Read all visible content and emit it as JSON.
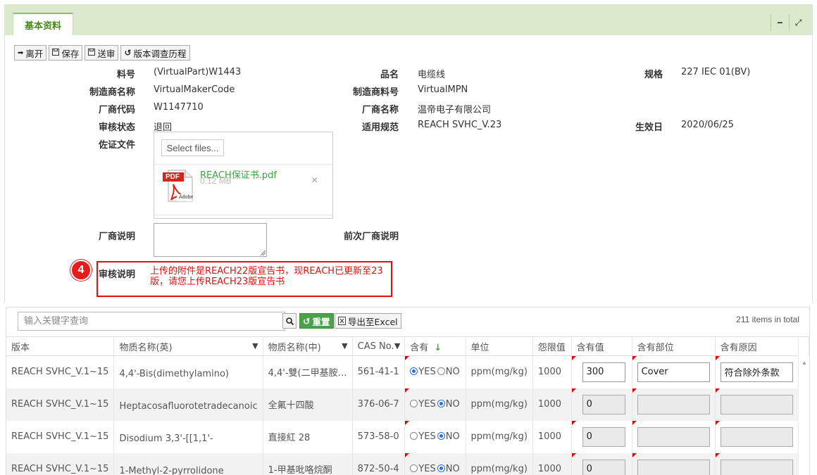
{
  "header": {
    "tab_label": "基本资料",
    "minimize_glyph": "−",
    "expand_glyph": "⤢"
  },
  "toolbar": {
    "leave_label": "离开",
    "save_label": "保存",
    "submit_label": "送审",
    "history_label": "版本调查历程"
  },
  "form": {
    "part_no_label": "料号",
    "part_no": "(VirtualPart)W1443",
    "product_name_label": "品名",
    "product_name": "电缆线",
    "spec_label": "规格",
    "spec": "227 IEC 01(BV)",
    "maker_name_label": "制造商名称",
    "maker_name": "VirtualMakerCode",
    "maker_part_label": "制造商料号",
    "maker_part": "VirtualMPN",
    "vendor_code_label": "厂商代码",
    "vendor_code": "W1147710",
    "vendor_name_label": "厂商名称",
    "vendor_name": "温帝电子有限公司",
    "audit_status_label": "审核状态",
    "audit_status": "退回",
    "regulation_label": "适用规范",
    "regulation": "REACH SVHC_V.23",
    "effective_date_label": "生效日",
    "effective_date": "2020/06/25",
    "evidence_label": "佐证文件",
    "select_files_label": "Select files...",
    "file_name": "REACH保证书.pdf",
    "file_size": "0.12 MB",
    "file_icon_text": "PDF",
    "file_icon_brand": "Adobe",
    "remove_glyph": "×",
    "vendor_note_label": "厂商说明",
    "prev_vendor_note_label": "前次厂商说明",
    "audit_note_label": "审核说明",
    "audit_note": "上传的附件是REACH22版宣告书，现REACH已更新至23版，请您上传REACH23版宣告书",
    "step_badge": "4"
  },
  "grid": {
    "search_placeholder": "输入关键字查询",
    "reset_label": "重置",
    "export_label": "导出至Excel",
    "total_text": "211 items in total",
    "columns": [
      "版本",
      "物质名称(英)",
      "物质名称(中)",
      "CAS No.",
      "含有",
      "单位",
      "怨限值",
      "含有值",
      "含有部位",
      "含有原因"
    ],
    "sort_glyph": "↓",
    "yes_label": "YES",
    "no_label": "NO",
    "rows": [
      {
        "version": "REACH SVHC_V.1~15",
        "name_en": "4,4'-Bis(dimethylamino)",
        "name_cn": "4,4'-雙(二甲基胺…",
        "cas": "561-41-1",
        "contains": "yes",
        "unit": "ppm(mg/kg)",
        "limit": "1000",
        "value": "300",
        "part": "Cover",
        "reason": "符合除外条款"
      },
      {
        "version": "REACH SVHC_V.1~15",
        "name_en": "Heptacosafluorotetradecanoic",
        "name_cn": "全氟十四酸",
        "cas": "376-06-7",
        "contains": "no",
        "unit": "ppm(mg/kg)",
        "limit": "1000",
        "value": "0",
        "part": "",
        "reason": ""
      },
      {
        "version": "REACH SVHC_V.1~15",
        "name_en": "Disodium 3,3'-[[1,1'-",
        "name_cn": "直接紅 28",
        "cas": "573-58-0",
        "contains": "no",
        "unit": "ppm(mg/kg)",
        "limit": "1000",
        "value": "0",
        "part": "",
        "reason": ""
      },
      {
        "version": "REACH SVHC_V.1~15",
        "name_en": "1-Methyl-2-pyrrolidone",
        "name_cn": "1-甲基吡咯烷酮",
        "cas": "872-50-4",
        "contains": "no",
        "unit": "ppm(mg/kg)",
        "limit": "1000",
        "value": "0",
        "part": "",
        "reason": ""
      }
    ]
  }
}
